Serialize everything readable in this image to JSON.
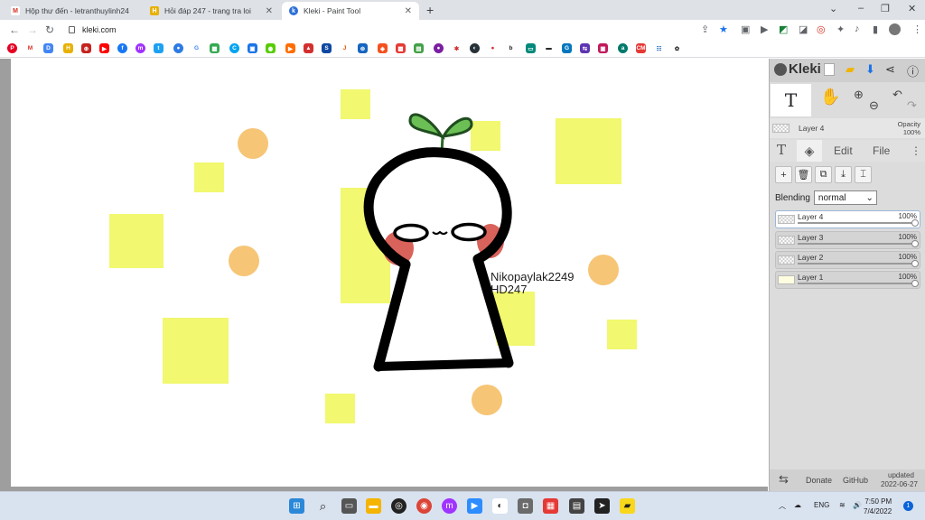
{
  "browser": {
    "tabs": [
      {
        "title": "Hộp thư đến - letranthuylinh24",
        "favicon": "gmail-icon"
      },
      {
        "title": "Hỏi đáp 247 - trang tra loi",
        "favicon": "hoidap-icon"
      },
      {
        "title": "Kleki - Paint Tool",
        "favicon": "kleki-icon",
        "active": true
      }
    ],
    "new_tab": "+",
    "window_controls": [
      "⌄",
      "–",
      "❐",
      "✕"
    ],
    "url": "kleki.com"
  },
  "canvas": {
    "signature_line1": "Nikopaylak2249",
    "signature_line2": "HD247",
    "colors": {
      "square": "#f2f86f",
      "dot": "#f6c576",
      "blush": "#d9625a",
      "sprout": "#6bbf55"
    }
  },
  "kleki": {
    "logo": "Kleki",
    "current_tool": "T",
    "current_layer": {
      "name": "Layer 4",
      "opacity_label": "Opacity",
      "opacity_value": "100%"
    },
    "tabs": {
      "text": "T",
      "edit": "Edit",
      "file": "File",
      "more": "⋮"
    },
    "blending": {
      "label": "Blending",
      "value": "normal"
    },
    "layers": [
      {
        "name": "Layer 4",
        "opacity": "100%",
        "selected": true
      },
      {
        "name": "Layer 3",
        "opacity": "100%"
      },
      {
        "name": "Layer 2",
        "opacity": "100%"
      },
      {
        "name": "Layer 1",
        "opacity": "100%"
      }
    ],
    "footer": {
      "swap": "⇆",
      "donate": "Donate",
      "github": "GitHub",
      "updated_label": "updated",
      "updated_date": "2022-06-27"
    }
  },
  "taskbar": {
    "lang": "ENG",
    "time": "7:50 PM",
    "date": "7/4/2022"
  }
}
